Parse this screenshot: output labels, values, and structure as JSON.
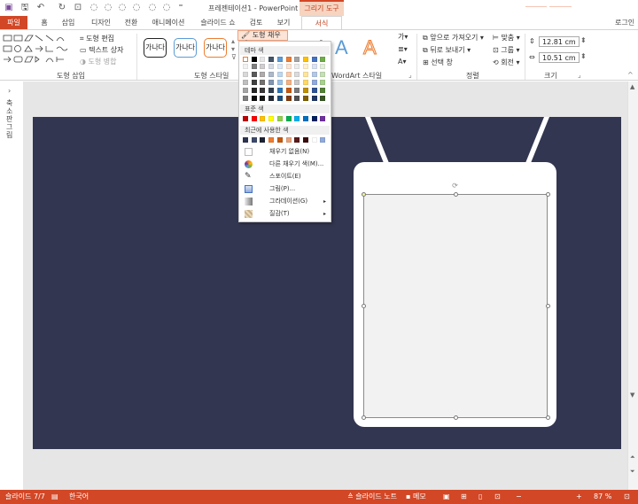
{
  "window": {
    "title": "프레젠테이션1 - PowerPoint",
    "context_group": "그리기 도구",
    "signin": "로그인"
  },
  "tabs": [
    "파일",
    "홈",
    "삽입",
    "디자인",
    "전환",
    "애니메이션",
    "슬라이드 쇼",
    "검토",
    "보기",
    "서식"
  ],
  "active_tab": "서식",
  "ribbon": {
    "groups": [
      "도형 삽입",
      "도형 스타일",
      "WordArt 스타일",
      "정렬",
      "크기"
    ],
    "insert_shapes": {
      "edit_shape": "도형 편집",
      "text_box": "텍스트 상자",
      "merge_shapes": "도형 병합"
    },
    "shape_style_tiles": [
      "가나다",
      "가나다",
      "가나다"
    ],
    "fill_button": "도형 채우기",
    "arrange": {
      "bring_forward": "앞으로 가져오기",
      "send_backward": "뒤로 보내기",
      "selection_pane": "선택 창",
      "align": "맞춤",
      "group": "그룹",
      "rotate": "회전"
    },
    "size": {
      "height": "12.81 cm",
      "width": "10.51 cm"
    }
  },
  "fill_menu": {
    "theme_colors_header": "테마 색",
    "standard_colors_header": "표준 색",
    "recent_colors_header": "최근에 사용한 색",
    "items": [
      {
        "label": "채우기 없음(N)",
        "icon": "none-icon"
      },
      {
        "label": "다른 채우기 색(M)...",
        "icon": "palette-icon"
      },
      {
        "label": "스포이트(E)",
        "icon": "eyedropper-icon"
      },
      {
        "label": "그림(P)...",
        "icon": "picture-icon"
      },
      {
        "label": "그라데이션(G)",
        "icon": "gradient-icon",
        "submenu": true
      },
      {
        "label": "질감(T)",
        "icon": "texture-icon",
        "submenu": true
      }
    ],
    "theme_colors": [
      [
        "#ffffff",
        "#000000",
        "#e7e6e6",
        "#44546a",
        "#5b9bd5",
        "#ed7d31",
        "#a5a5a5",
        "#ffc000",
        "#4472c4",
        "#70ad47"
      ],
      [
        "#f2f2f2",
        "#7f7f7f",
        "#d0cece",
        "#d6dce4",
        "#deebf6",
        "#fbe5d5",
        "#ededed",
        "#fff2cc",
        "#dae3f3",
        "#e2efd9"
      ],
      [
        "#d8d8d8",
        "#595959",
        "#aeabab",
        "#adb9ca",
        "#bdd7ee",
        "#f8cbad",
        "#dbdbdb",
        "#fee599",
        "#b4c7e7",
        "#c5e0b3"
      ],
      [
        "#bfbfbf",
        "#3f3f3f",
        "#757070",
        "#8496b0",
        "#9dc3e6",
        "#f4b183",
        "#c9c9c9",
        "#ffd965",
        "#8faadc",
        "#a8d08d"
      ],
      [
        "#a5a5a5",
        "#262626",
        "#3a3838",
        "#323f4f",
        "#2e75b5",
        "#c55a11",
        "#7b7b7b",
        "#bf9000",
        "#2f5496",
        "#538135"
      ],
      [
        "#7f7f7f",
        "#0c0c0c",
        "#171616",
        "#222a35",
        "#1e4e79",
        "#833c0b",
        "#525252",
        "#7f6000",
        "#1f3864",
        "#375623"
      ]
    ],
    "standard_colors": [
      "#c00000",
      "#ff0000",
      "#ffc000",
      "#ffff00",
      "#92d050",
      "#00b050",
      "#00b0f0",
      "#0070c0",
      "#002060",
      "#7030a0"
    ],
    "recent_colors": [
      "#2e3350",
      "#3c4a6b",
      "#1c2233",
      "#ed7d31",
      "#c55a11",
      "#e7a27c",
      "#5a1b1b",
      "#3a0c0c",
      "#ffffff",
      "#8faadc"
    ]
  },
  "side_panel": {
    "label": "축소판 그림"
  },
  "status": {
    "slide": "슬라이드 7/7",
    "language": "한국어",
    "notes": "슬라이드 노트",
    "comments": "메모",
    "zoom": "87 %"
  },
  "colors": {
    "accent": "#d24726",
    "slide_background": "#323650"
  }
}
